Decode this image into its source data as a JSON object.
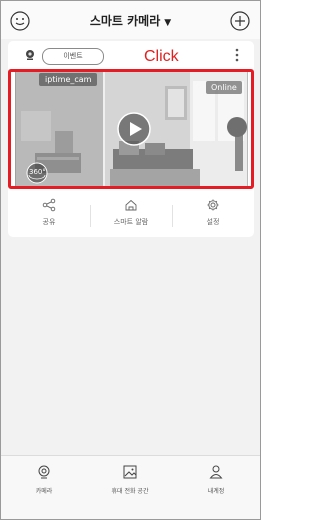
{
  "header": {
    "title": "스마트 카메라",
    "caret": "▼",
    "left_icon": "profile-menu-icon",
    "right_icon": "add-icon"
  },
  "card": {
    "event_label": "이벤트",
    "click_annotation": "Click",
    "camera_name": "iptime_cam",
    "status": "Online",
    "badge": "360°",
    "actions": [
      {
        "label": "공유",
        "icon": "share-icon"
      },
      {
        "label": "스마트 알람",
        "icon": "home-icon"
      },
      {
        "label": "설정",
        "icon": "gear-icon"
      }
    ]
  },
  "bottom_nav": [
    {
      "label": "카메라",
      "icon": "camera-icon"
    },
    {
      "label": "휴대 전화 공간",
      "icon": "gallery-icon"
    },
    {
      "label": "내계정",
      "icon": "account-icon"
    }
  ],
  "colors": {
    "highlight": "#e51c23",
    "click_text": "#e02020"
  }
}
